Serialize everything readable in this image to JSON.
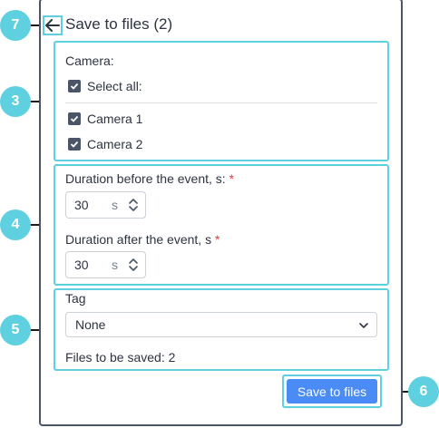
{
  "header": {
    "title": "Save to files (2)"
  },
  "camera_section": {
    "label": "Camera:",
    "select_all_label": "Select all:",
    "select_all_checked": true,
    "cameras": [
      {
        "label": "Camera 1",
        "checked": true
      },
      {
        "label": "Camera 2",
        "checked": true
      }
    ]
  },
  "duration_section": {
    "before_label": "Duration before the event, s:",
    "before_value": "30",
    "before_unit": "s",
    "after_label": "Duration after the event, s",
    "after_value": "30",
    "after_unit": "s",
    "required_mark": "*"
  },
  "tag_section": {
    "label": "Tag",
    "selected": "None",
    "files_count_text": "Files to be saved: 2"
  },
  "footer": {
    "save_label": "Save to files"
  },
  "callouts": {
    "c7": "7",
    "c3": "3",
    "c4": "4",
    "c5": "5",
    "c6": "6"
  },
  "colors": {
    "accent": "#5ed0e0",
    "primary": "#4a8bf5",
    "required": "#e53e3e",
    "checkbox": "#4a5568"
  },
  "icons": {
    "back": "arrow-left-icon",
    "check": "checkmark-icon",
    "spinner": "up-down-chevron-icon",
    "dropdown": "chevron-down-icon"
  }
}
